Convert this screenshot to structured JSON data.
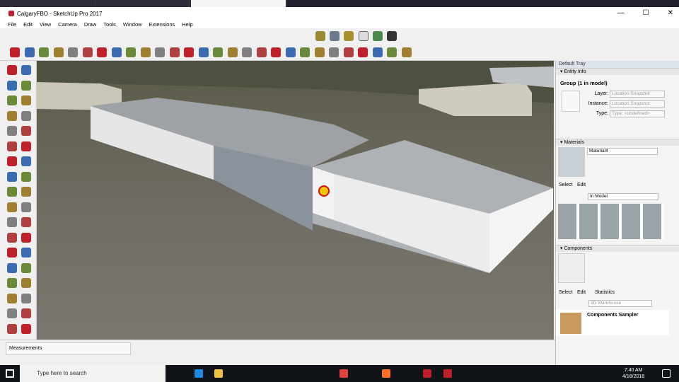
{
  "window": {
    "title": "CalgaryFBO - SketchUp Pro 2017",
    "minimize": "—",
    "maximize": "☐",
    "close": "✕"
  },
  "menu": [
    "File",
    "Edit",
    "View",
    "Camera",
    "Draw",
    "Tools",
    "Window",
    "Extensions",
    "Help"
  ],
  "colors": {
    "accent": "#c0202a",
    "taskbar": "#101418",
    "tray_header": "#dde3ea"
  },
  "tray": {
    "title": "Default Tray",
    "entity_info": {
      "header": "Entity Info",
      "selection": "Group (1 in model)",
      "layer_label": "Layer:",
      "layer_value": "Location Snapshot",
      "instance_label": "Instance:",
      "instance_value": "Location Snapshot",
      "type_label": "Type:",
      "type_value": "Type: <undefined>"
    },
    "materials": {
      "header": "Materials",
      "name": "Material4",
      "tab_select": "Select",
      "tab_edit": "Edit",
      "collection": "In Model"
    },
    "components": {
      "header": "Components",
      "tab_select": "Select",
      "tab_edit": "Edit",
      "tab_statistics": "Statistics",
      "search_placeholder": "3D Warehouse",
      "item": "Components Sampler"
    }
  },
  "measurements": {
    "label": "Measurements"
  },
  "taskbar": {
    "search_placeholder": "Type here to search",
    "time": "7:40 AM",
    "date": "4/18/2018"
  }
}
